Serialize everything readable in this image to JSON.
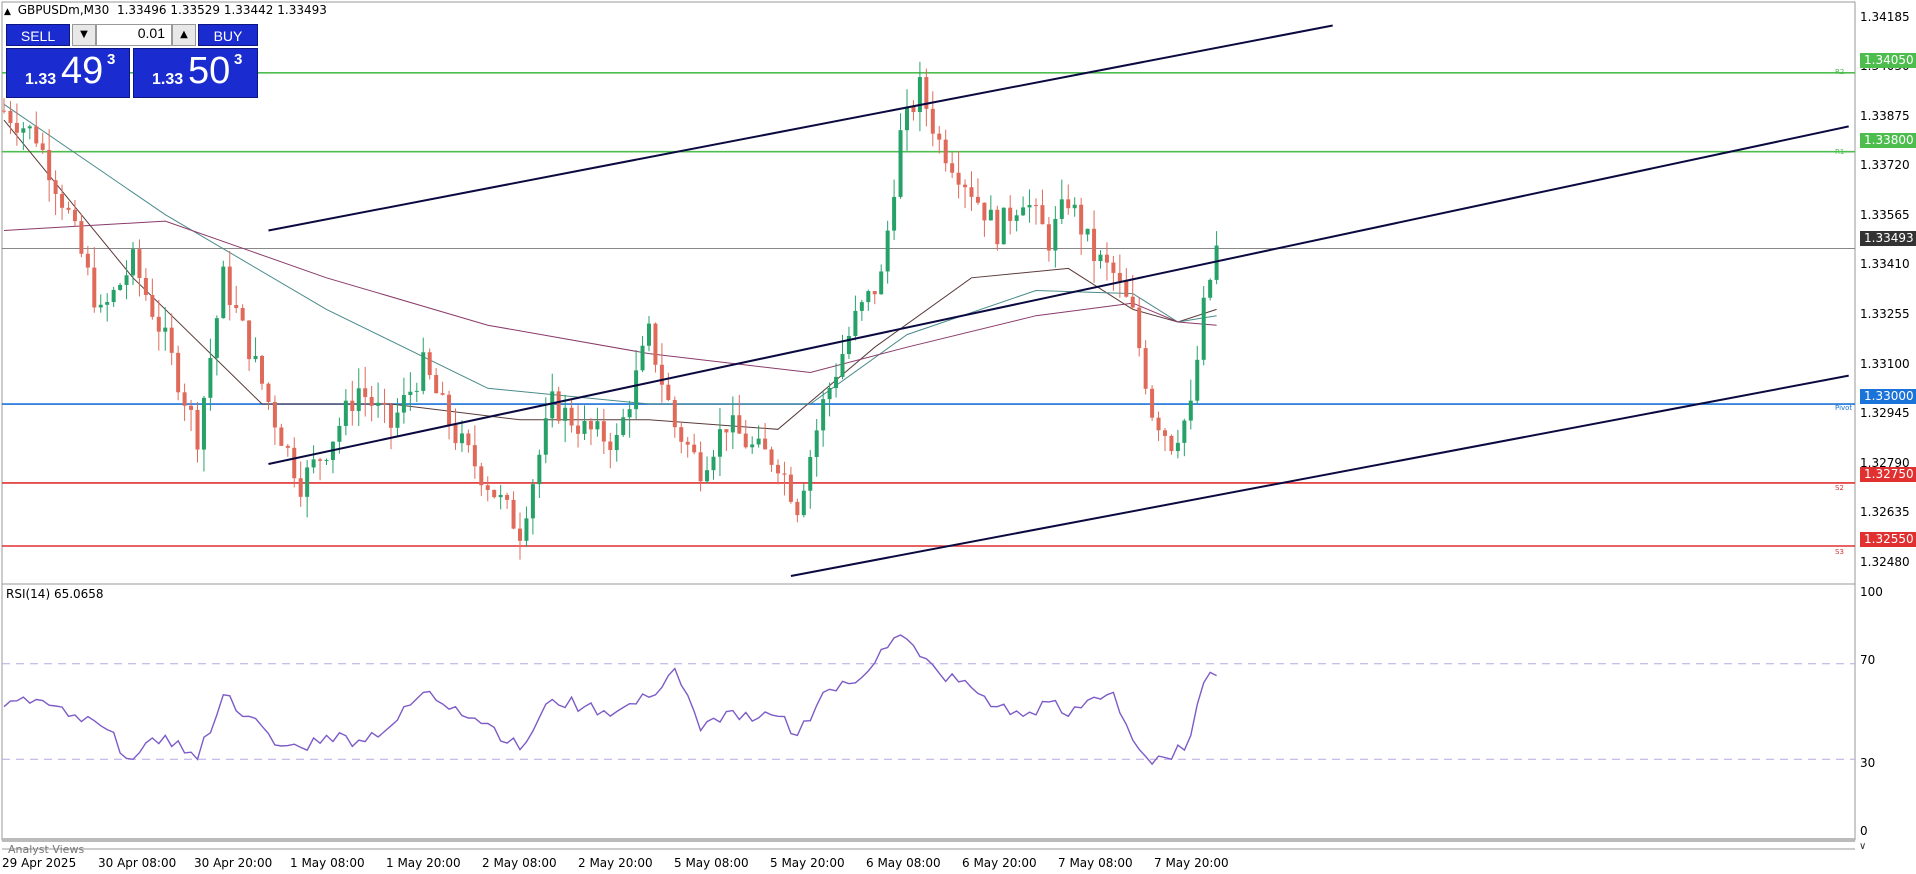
{
  "header": {
    "symbol": "GBPUSDm,M30",
    "quote": "1.33496 1.33529 1.33442 1.33493"
  },
  "trade_panel": {
    "sell_label": "SELL",
    "buy_label": "BUY",
    "lot": "0.01",
    "bid_prefix": "1.33",
    "bid_big": "49",
    "bid_sup": "3",
    "ask_prefix": "1.33",
    "ask_big": "50",
    "ask_sup": "3"
  },
  "price_axis": {
    "ticks": [
      "1.34185",
      "1.34030",
      "1.33875",
      "1.33720",
      "1.33565",
      "1.33410",
      "1.33255",
      "1.33100",
      "1.32945",
      "1.32790",
      "1.32635",
      "1.32480"
    ],
    "current": "1.33493"
  },
  "levels": {
    "r2": {
      "value": "1.34050",
      "name": "R2",
      "color": "#4dbd4d"
    },
    "r1": {
      "value": "1.33800",
      "name": "R1",
      "color": "#4dbd4d"
    },
    "pivot": {
      "value": "1.33000",
      "name": "Pivot",
      "color": "#1a73d9"
    },
    "s2": {
      "value": "1.32750",
      "name": "S2",
      "color": "#e03030"
    },
    "s3": {
      "value": "1.32550",
      "name": "S3",
      "color": "#e03030"
    }
  },
  "rsi": {
    "title": "RSI(14) 65.0658",
    "ticks": [
      "100",
      "70",
      "30",
      "0"
    ],
    "color": "#7d5bc7"
  },
  "time_axis": [
    "29 Apr 2025",
    "30 Apr 08:00",
    "30 Apr 20:00",
    "1 May 08:00",
    "1 May 20:00",
    "2 May 08:00",
    "2 May 20:00",
    "5 May 08:00",
    "5 May 20:00",
    "6 May 08:00",
    "6 May 20:00",
    "7 May 08:00",
    "7 May 20:00"
  ],
  "bottom_tab": "Analyst Views",
  "chart_data": {
    "type": "candlestick",
    "symbol": "GBPUSDm",
    "timeframe": "M30",
    "ylim": [
      1.3242,
      1.3423
    ],
    "current_price": 1.33493,
    "up_color": "#26a269",
    "down_color": "#e06a5a",
    "close_path": [
      [
        0,
        1.3393
      ],
      [
        5,
        1.3385
      ],
      [
        10,
        1.336
      ],
      [
        15,
        1.3328
      ],
      [
        20,
        1.3345
      ],
      [
        25,
        1.332
      ],
      [
        30,
        1.329
      ],
      [
        34,
        1.334
      ],
      [
        38,
        1.3318
      ],
      [
        42,
        1.3295
      ],
      [
        46,
        1.3275
      ],
      [
        50,
        1.3286
      ],
      [
        55,
        1.3305
      ],
      [
        60,
        1.3293
      ],
      [
        65,
        1.3312
      ],
      [
        70,
        1.329
      ],
      [
        75,
        1.3275
      ],
      [
        80,
        1.326
      ],
      [
        85,
        1.33
      ],
      [
        90,
        1.3292
      ],
      [
        95,
        1.3288
      ],
      [
        100,
        1.3322
      ],
      [
        104,
        1.3293
      ],
      [
        108,
        1.328
      ],
      [
        112,
        1.3294
      ],
      [
        116,
        1.3286
      ],
      [
        120,
        1.3282
      ],
      [
        123,
        1.3268
      ],
      [
        127,
        1.33
      ],
      [
        132,
        1.3327
      ],
      [
        136,
        1.334
      ],
      [
        139,
        1.3385
      ],
      [
        142,
        1.34
      ],
      [
        145,
        1.3383
      ],
      [
        150,
        1.3368
      ],
      [
        154,
        1.3355
      ],
      [
        158,
        1.3366
      ],
      [
        162,
        1.3352
      ],
      [
        165,
        1.3365
      ],
      [
        169,
        1.3347
      ],
      [
        172,
        1.3341
      ],
      [
        175,
        1.3328
      ],
      [
        178,
        1.3298
      ],
      [
        181,
        1.3288
      ],
      [
        184,
        1.3298
      ],
      [
        186,
        1.333
      ],
      [
        188,
        1.3349
      ]
    ],
    "moving_averages": [
      {
        "name": "MA fast",
        "color": "#5a3a3a",
        "points": [
          [
            0,
            1.339
          ],
          [
            20,
            1.334
          ],
          [
            40,
            1.33
          ],
          [
            60,
            1.33
          ],
          [
            80,
            1.3295
          ],
          [
            100,
            1.3295
          ],
          [
            120,
            1.3292
          ],
          [
            135,
            1.3318
          ],
          [
            150,
            1.334
          ],
          [
            165,
            1.3343
          ],
          [
            175,
            1.333
          ],
          [
            182,
            1.3326
          ],
          [
            188,
            1.333
          ]
        ]
      },
      {
        "name": "MA medium",
        "color": "#4a8a8a",
        "points": [
          [
            0,
            1.3395
          ],
          [
            25,
            1.336
          ],
          [
            50,
            1.333
          ],
          [
            75,
            1.3305
          ],
          [
            100,
            1.33
          ],
          [
            125,
            1.33
          ],
          [
            140,
            1.3322
          ],
          [
            160,
            1.3336
          ],
          [
            175,
            1.3335
          ],
          [
            182,
            1.3326
          ],
          [
            188,
            1.3328
          ]
        ]
      },
      {
        "name": "MA slow",
        "color": "#8a3a6a",
        "points": [
          [
            0,
            1.3355
          ],
          [
            25,
            1.3358
          ],
          [
            50,
            1.334
          ],
          [
            75,
            1.3325
          ],
          [
            100,
            1.3316
          ],
          [
            125,
            1.331
          ],
          [
            140,
            1.3318
          ],
          [
            160,
            1.3328
          ],
          [
            175,
            1.3332
          ],
          [
            182,
            1.3326
          ],
          [
            188,
            1.3325
          ]
        ]
      }
    ],
    "channel_lines": [
      {
        "x": [
          41,
          206
        ],
        "y": [
          1.3355,
          1.342
        ]
      },
      {
        "x": [
          41,
          286
        ],
        "y": [
          1.3281,
          1.3388
        ]
      },
      {
        "x": [
          122,
          286
        ],
        "y": [
          1.32455,
          1.3309
        ]
      }
    ],
    "rsi_series": [
      [
        0,
        52
      ],
      [
        5,
        55
      ],
      [
        10,
        48
      ],
      [
        15,
        44
      ],
      [
        20,
        30
      ],
      [
        25,
        40
      ],
      [
        30,
        30
      ],
      [
        34,
        57
      ],
      [
        38,
        48
      ],
      [
        42,
        36
      ],
      [
        46,
        35
      ],
      [
        50,
        40
      ],
      [
        55,
        38
      ],
      [
        60,
        44
      ],
      [
        65,
        58
      ],
      [
        70,
        52
      ],
      [
        75,
        45
      ],
      [
        80,
        34
      ],
      [
        85,
        55
      ],
      [
        90,
        52
      ],
      [
        95,
        50
      ],
      [
        100,
        56
      ],
      [
        104,
        68
      ],
      [
        108,
        42
      ],
      [
        112,
        50
      ],
      [
        116,
        46
      ],
      [
        120,
        48
      ],
      [
        123,
        40
      ],
      [
        127,
        58
      ],
      [
        132,
        62
      ],
      [
        136,
        76
      ],
      [
        139,
        82
      ],
      [
        142,
        73
      ],
      [
        145,
        66
      ],
      [
        150,
        60
      ],
      [
        154,
        52
      ],
      [
        158,
        48
      ],
      [
        162,
        54
      ],
      [
        165,
        48
      ],
      [
        169,
        56
      ],
      [
        172,
        58
      ],
      [
        175,
        38
      ],
      [
        178,
        28
      ],
      [
        181,
        30
      ],
      [
        184,
        40
      ],
      [
        186,
        62
      ],
      [
        188,
        65
      ]
    ]
  }
}
